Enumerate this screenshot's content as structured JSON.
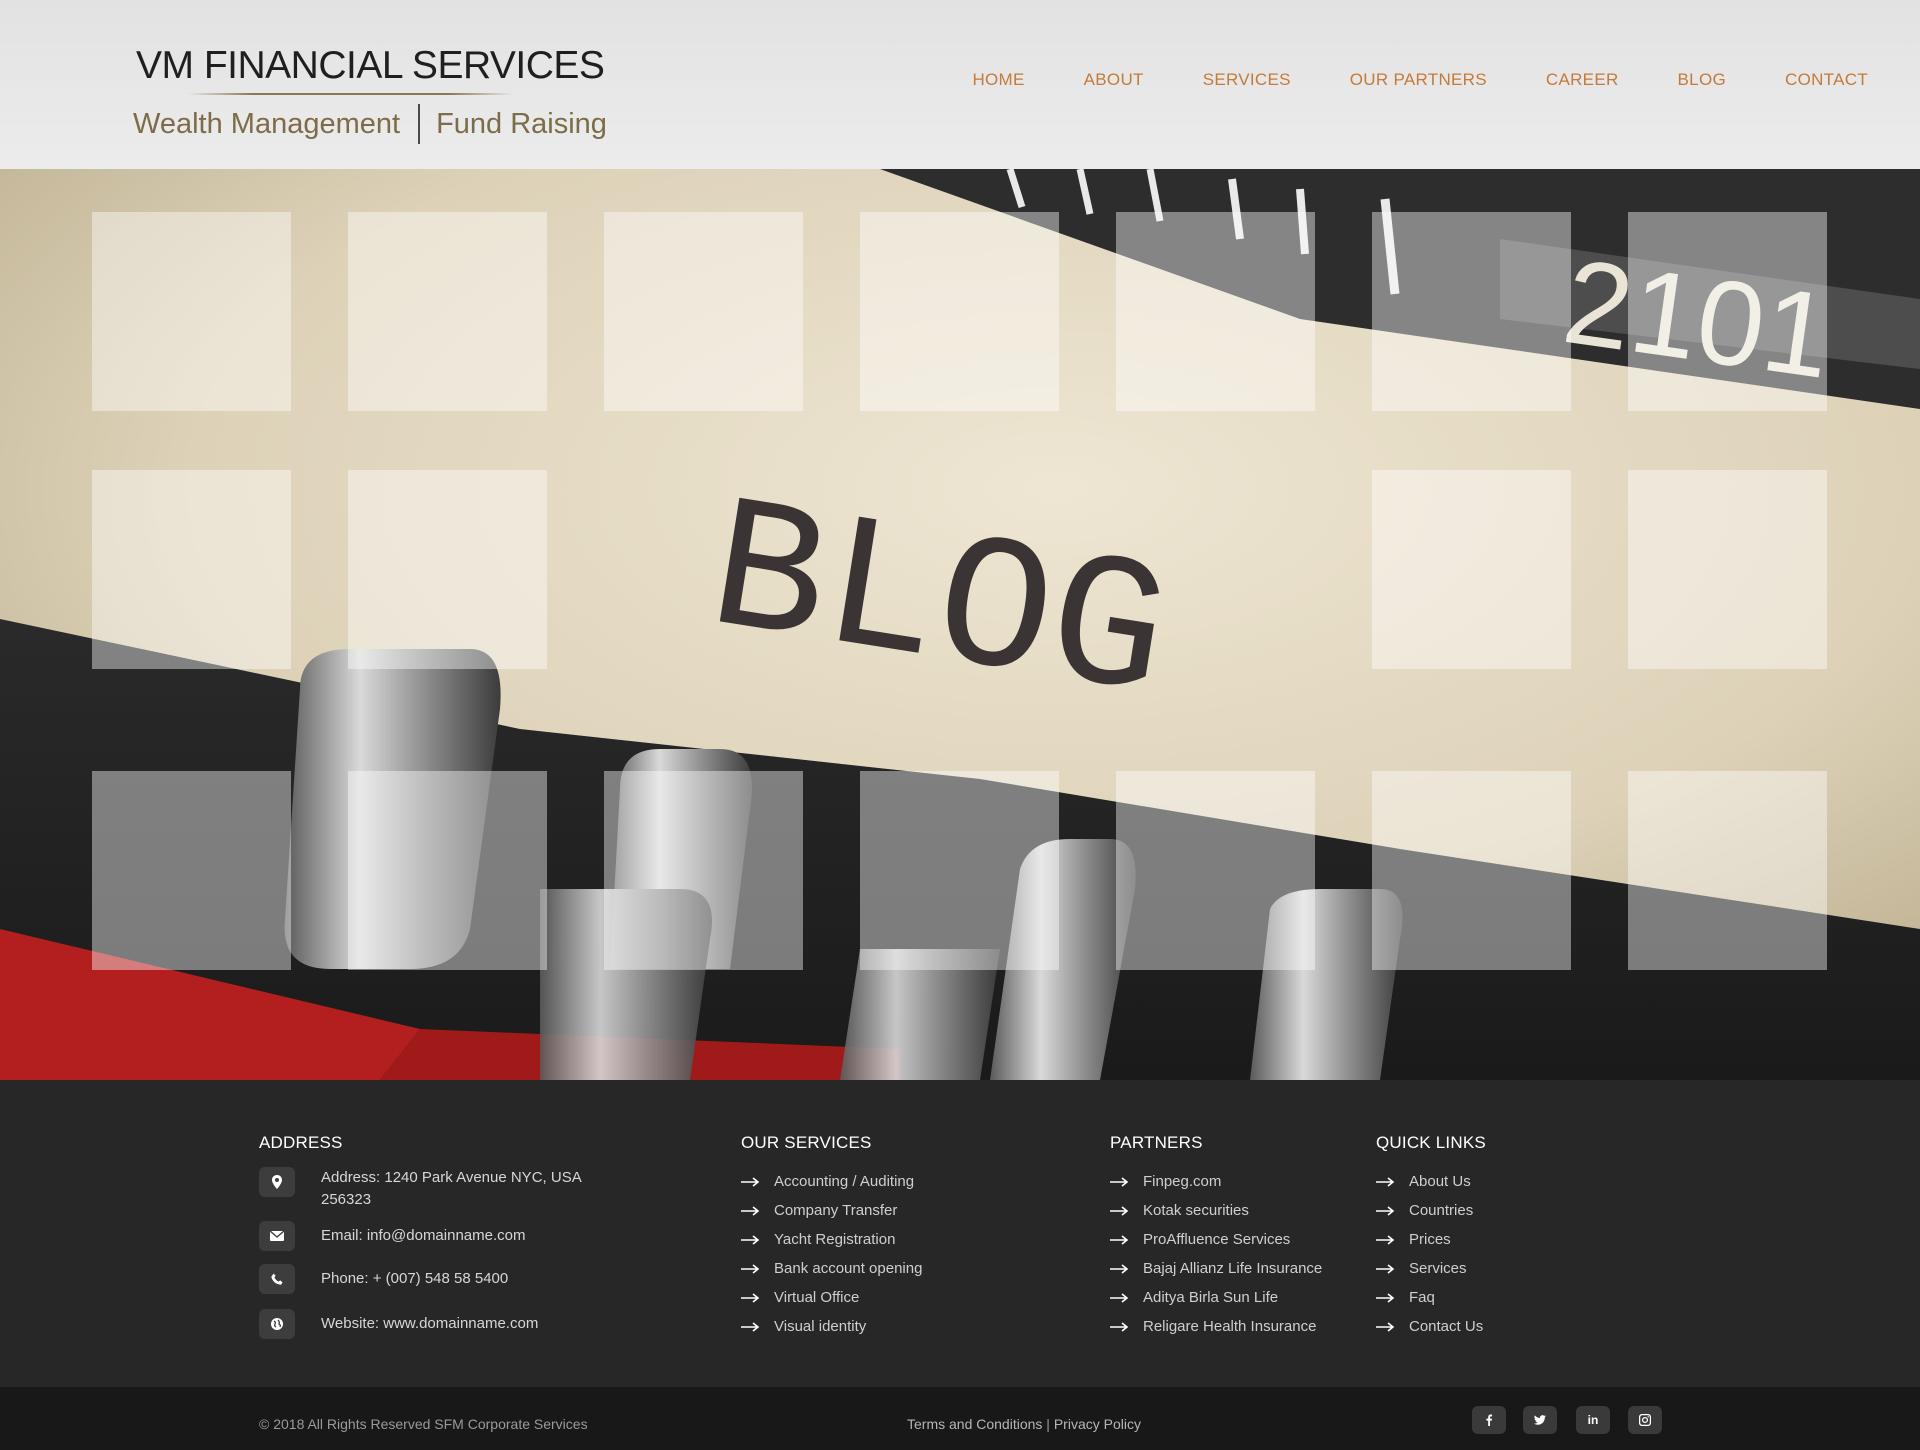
{
  "brand": {
    "title": "VM FINANCIAL SERVICES",
    "sub_left": "Wealth Management",
    "sub_right": "Fund Raising"
  },
  "nav": {
    "items": [
      "HOME",
      "ABOUT",
      "SERVICES",
      "OUR PARTNERS",
      "CAREER",
      "BLOG",
      "CONTACT"
    ],
    "color": "#c47a3a"
  },
  "hero": {
    "word": "BLOG",
    "counter_digits": "2 1 0",
    "description_icon": "typewriter-photo"
  },
  "footer": {
    "address": {
      "heading": "ADDRESS",
      "rows": [
        {
          "icon": "map-pin-icon",
          "text": "Address: 1240 Park Avenue NYC, USA 256323"
        },
        {
          "icon": "envelope-icon",
          "text": "Email: info@domainname.com"
        },
        {
          "icon": "phone-icon",
          "text": "Phone: + (007) 548 58 5400"
        },
        {
          "icon": "globe-icon",
          "text": "Website: www.domainname.com"
        }
      ]
    },
    "services": {
      "heading": "OUR SERVICES",
      "items": [
        "Accounting / Auditing",
        "Company Transfer",
        "Yacht Registration",
        "Bank account opening",
        "Virtual Office",
        "Visual identity"
      ]
    },
    "partners": {
      "heading": "PARTNERS",
      "items": [
        "Finpeg.com",
        "Kotak securities",
        "ProAffluence Services",
        "Bajaj Allianz Life Insurance",
        "Aditya Birla Sun Life",
        "Religare Health Insurance"
      ]
    },
    "quick": {
      "heading": "QUICK LINKS",
      "items": [
        "About Us",
        "Countries",
        "Prices",
        "Services",
        "Faq",
        "Contact Us"
      ]
    }
  },
  "bottom": {
    "copyright": "© 2018 All Rights Reserved SFM Corporate Services",
    "terms": "Terms and Conditions",
    "separator": " | ",
    "privacy": "Privacy Policy",
    "social": [
      "facebook-icon",
      "twitter-icon",
      "linkedin-icon",
      "instagram-icon"
    ]
  }
}
